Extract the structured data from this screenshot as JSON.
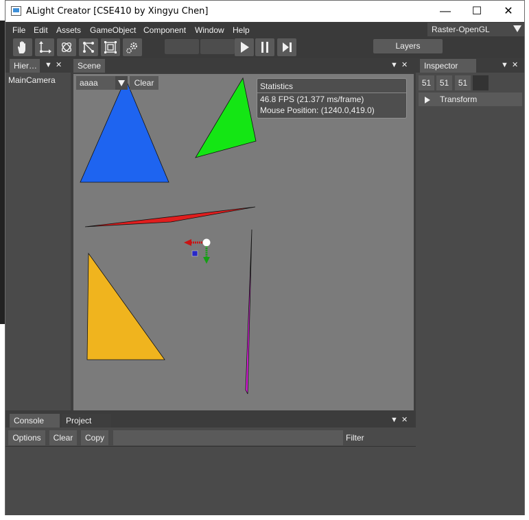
{
  "window": {
    "title": "ALight Creator [CSE410 by Xingyu Chen]",
    "minimize": "—",
    "maximize": "☐",
    "close": "✕"
  },
  "menu": {
    "items": [
      "File",
      "Edit",
      "Assets",
      "GameObject",
      "Component",
      "Window",
      "Help"
    ],
    "renderer": "Raster-OpenGL"
  },
  "toolbar": {
    "tools": [
      "hand-icon",
      "move-icon",
      "rotate-icon",
      "scale-icon",
      "rect-icon",
      "settings-icon"
    ],
    "layers": "Layers"
  },
  "hierarchy": {
    "tab": "Hier…",
    "items": [
      "MainCamera"
    ]
  },
  "scene": {
    "tab": "Scene",
    "dropdown_value": "aaaa",
    "clear": "Clear",
    "stats": {
      "title": "Statistics",
      "fps": "46.8 FPS (21.377 ms/frame)",
      "mouse": "Mouse Position: (1240.0,419.0)"
    },
    "shapes": [
      {
        "name": "blue-triangle",
        "color": "#1e64f0"
      },
      {
        "name": "green-triangle",
        "color": "#14e614"
      },
      {
        "name": "red-sliver",
        "color": "#e01e1e"
      },
      {
        "name": "yellow-triangle",
        "color": "#f0b41e"
      },
      {
        "name": "magenta-sliver",
        "color": "#e01ee0"
      }
    ],
    "gizmo_colors": {
      "x": "#c81414",
      "y": "#14a014",
      "z": "#2828c8"
    }
  },
  "inspector": {
    "tab": "Inspector",
    "color_values": [
      "51",
      "51",
      "51"
    ],
    "swatch_color": "#333333",
    "transform": "Transform"
  },
  "console": {
    "tabs": [
      "Console",
      "Project"
    ],
    "options": "Options",
    "clear": "Clear",
    "copy": "Copy",
    "filter": "Filter"
  }
}
